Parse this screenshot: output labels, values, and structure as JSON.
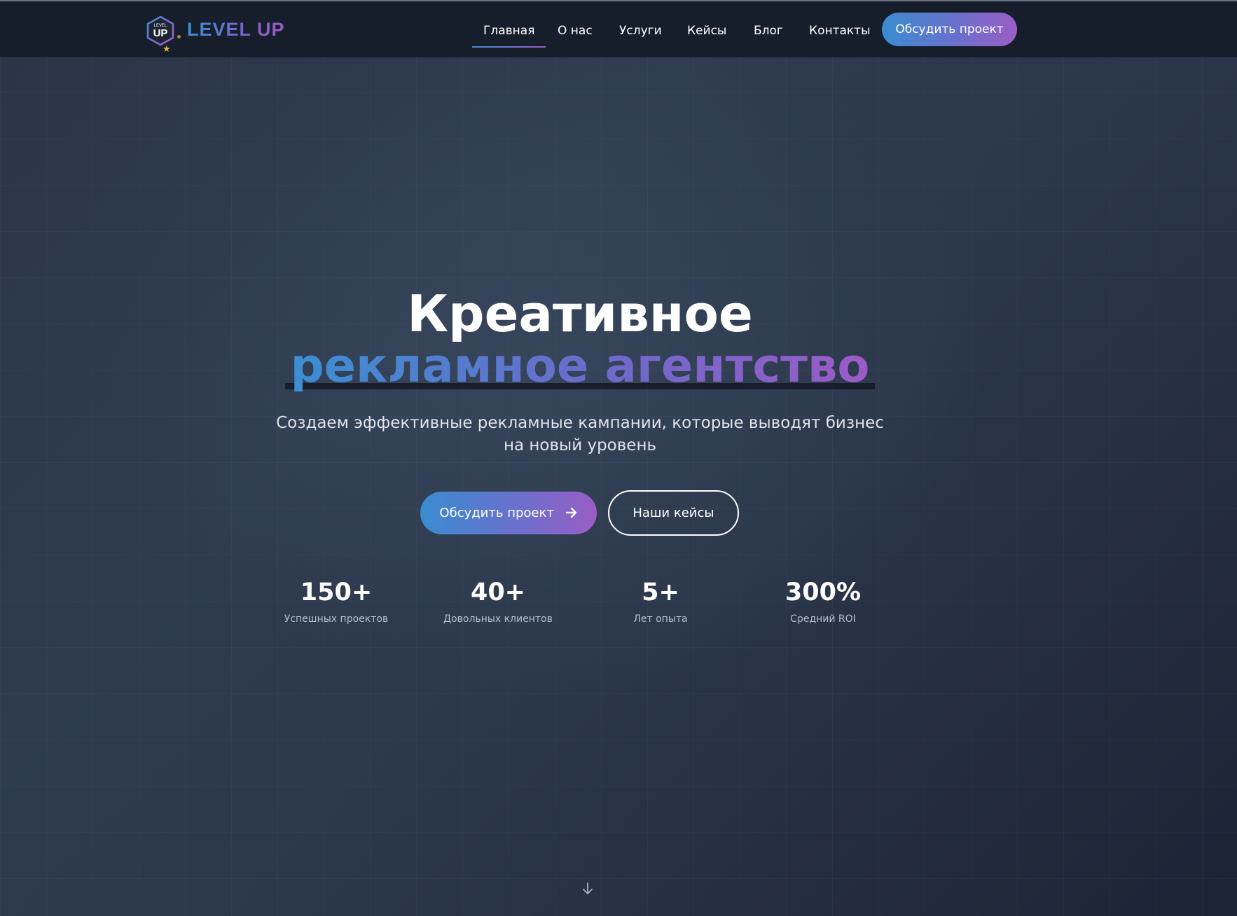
{
  "header": {
    "logo_text": "LEVEL UP",
    "logo_badge_small": "LEVEL",
    "logo_badge_big": "UP",
    "nav": [
      {
        "label": "Главная",
        "active": true
      },
      {
        "label": "О нас"
      },
      {
        "label": "Услуги"
      },
      {
        "label": "Кейсы"
      },
      {
        "label": "Блог"
      },
      {
        "label": "Контакты"
      }
    ],
    "cta_label": "Обсудить проект"
  },
  "hero": {
    "title_line1": "Креативное",
    "title_line2": "рекламное агентство",
    "subtitle": "Создаем эффективные рекламные кампании, которые выводят бизнес на новый уровень",
    "primary_button": "Обсудить проект",
    "secondary_button": "Наши кейсы"
  },
  "stats": [
    {
      "value": "150+",
      "label": "Успешных проектов"
    },
    {
      "value": "40+",
      "label": "Довольных клиентов"
    },
    {
      "value": "5+",
      "label": "Лет опыта"
    },
    {
      "value": "300%",
      "label": "Средний ROI"
    }
  ],
  "icons": {
    "primary_button_icon": "arrow-right-icon",
    "scroll_icon": "arrow-down-icon",
    "logo_icon": "hexagon-badge-icon"
  },
  "colors": {
    "gradient_start": "#3a8cd0",
    "gradient_end": "#9a5dc6",
    "header_bg": "#161e2c",
    "page_bg": "#2a3547"
  }
}
